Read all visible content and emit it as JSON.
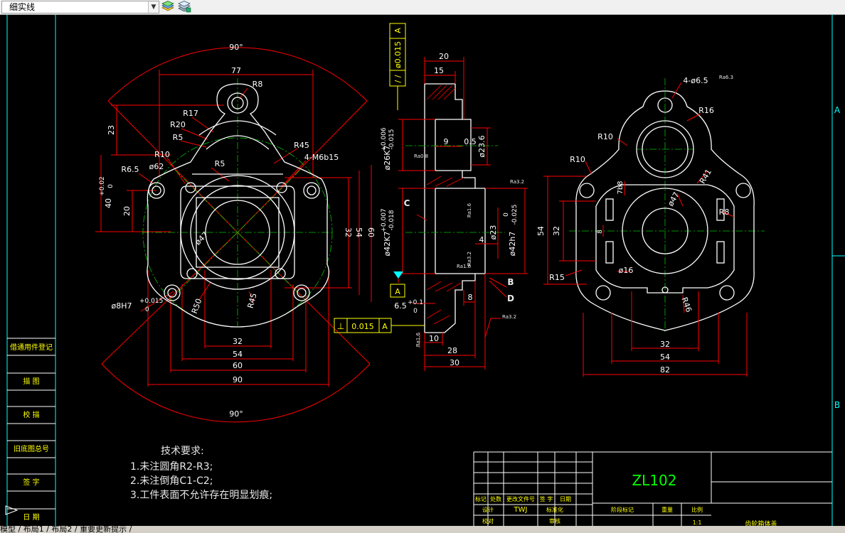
{
  "toolbar": {
    "linetype_value": "细实线",
    "dropdown_glyph": "▼",
    "icons": [
      "layer-states-icon",
      "layer-manager-icon"
    ]
  },
  "colors": {
    "dimension": "#ff0000",
    "outline": "#ffffff",
    "centerline": "#00c000",
    "text_dim": "#ffffff",
    "annotation": "#ffff00",
    "border": "#00ffff",
    "background": "#000000"
  },
  "frame_letters": [
    "A",
    "B"
  ],
  "front_view": {
    "dims": [
      "90°",
      "77",
      "R8",
      "R17",
      "R20",
      "R5",
      "R10",
      "R5",
      "R45",
      "4-M6b15",
      "23",
      "R6.5",
      "ø62",
      "40",
      "+0.02",
      "0",
      "20",
      "32",
      "54",
      "60",
      "ø47",
      "ø8H7",
      "+0.015",
      "0",
      "R50",
      "R45",
      "32",
      "54",
      "60",
      "90",
      "90°"
    ]
  },
  "side_view": {
    "datum_frame": [
      "/ /",
      "ø0.015",
      "A"
    ],
    "dims": [
      "20",
      "15",
      "9",
      "0.5",
      "ø23.6",
      "ø26K7",
      "+0.006",
      "-0.015",
      "ø42K7",
      "+0.007",
      "-0.018",
      "ø23",
      "ø42h7",
      "0",
      "-0.025",
      "4",
      "8",
      "6.5",
      "+0.1",
      "0",
      "10",
      "28",
      "30"
    ],
    "labels": [
      "C",
      "B",
      "D",
      "A"
    ],
    "roughness": [
      "Ra0.8",
      "Ra3.2",
      "Ra3.2",
      "Ra1.6",
      "Ra1.6",
      "Ra3.2",
      "Ra1.6"
    ],
    "flatness_frame": [
      "⊥",
      "0.015",
      "A"
    ]
  },
  "right_view": {
    "dims": [
      "4-ø6.5",
      "Ra6.3",
      "R16",
      "R10",
      "R10",
      "R41",
      "7b8",
      "ø47",
      "R8",
      "54",
      "32",
      "8",
      "R15",
      "ø16",
      "R46",
      "32",
      "54",
      "82"
    ]
  },
  "notes": {
    "title": "技术要求:",
    "items": [
      "1.未注圆角R2-R3;",
      "2.未注倒角C1-C2;",
      "3.工件表面不允许存在明显划痕;"
    ]
  },
  "left_column": [
    "借通用件登记",
    "描  图",
    "校  描",
    "旧底图总号",
    "签  字",
    "日  期"
  ],
  "title_block": {
    "material": "ZL102",
    "row_labels": [
      "标记",
      "处数",
      "更改文件号",
      "签  字",
      "日期"
    ],
    "design_row": [
      "设计",
      "TWJ",
      "标准化"
    ],
    "review_row": [
      "校对",
      "审核"
    ],
    "stage_labels": [
      "阶段标记",
      "重量",
      "比例"
    ],
    "scale": "1:1",
    "part_name": "齿轮箱体盖"
  },
  "layout_tabs": "模型 / 布局1 / 布局2 / 重要更新提示 /"
}
